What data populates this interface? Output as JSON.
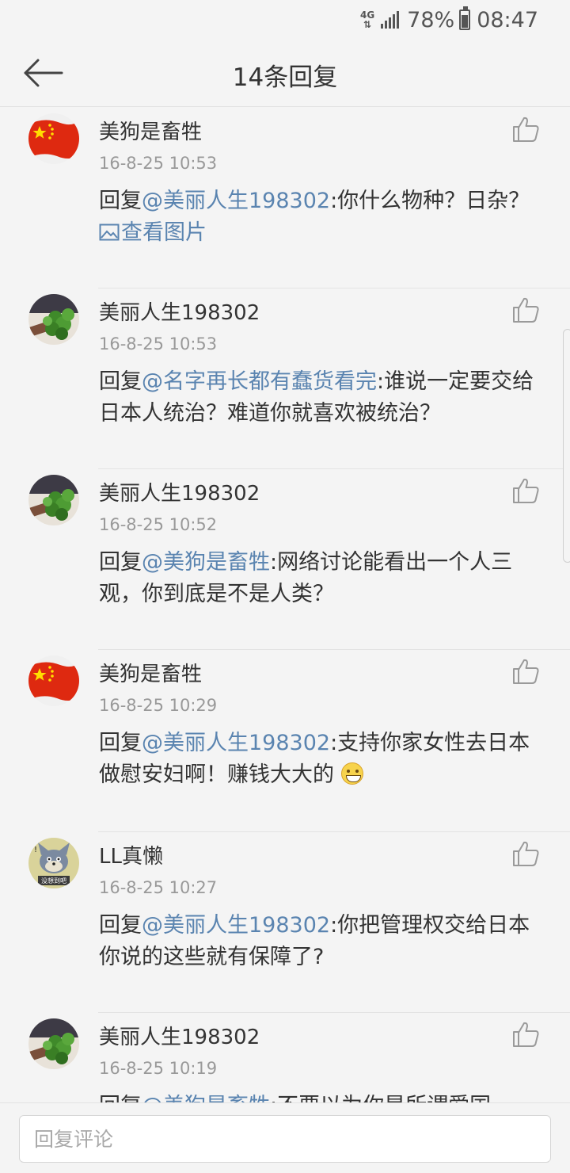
{
  "status_bar": {
    "network": "4G",
    "battery": "78%",
    "time": "08:47"
  },
  "header": {
    "title": "14条回复"
  },
  "replies": [
    {
      "user": "美狗是畜牲",
      "avatar": "china-flag-avatar",
      "time": "16-8-25 10:53",
      "prefix": "回复",
      "mention": "@美丽人生198302",
      "text": ":你什么物种？日杂？ ",
      "image_link": "查看图片"
    },
    {
      "user": "美丽人生198302",
      "avatar": "plant-avatar",
      "time": "16-8-25 10:53",
      "prefix": "回复",
      "mention": "@名字再长都有蠢货看完",
      "text": ":谁说一定要交给日本人统治？难道你就喜欢被统治？"
    },
    {
      "user": "美丽人生198302",
      "avatar": "plant-avatar",
      "time": "16-8-25 10:52",
      "prefix": "回复",
      "mention": "@美狗是畜牲",
      "text": ":网络讨论能看出一个人三观，你到底是不是人类？"
    },
    {
      "user": "美狗是畜牲",
      "avatar": "china-flag-avatar",
      "time": "16-8-25 10:29",
      "prefix": "回复",
      "mention": "@美丽人生198302",
      "text": ":支持你家女性去日本做慰安妇啊！赚钱大大的 "
    },
    {
      "user": "LL真懒",
      "avatar": "cartoon-cat-avatar",
      "avatar_caption": "没想到吧",
      "time": "16-8-25 10:27",
      "prefix": "回复",
      "mention": "@美丽人生198302",
      "text": ":你把管理权交给日本你说的这些就有保障了?"
    },
    {
      "user": "美丽人生198302",
      "avatar": "plant-avatar",
      "time": "16-8-25 10:19",
      "prefix": "回复",
      "mention": "@美狗是畜牲",
      "text": ":不要以为你是所谓爱国"
    }
  ],
  "reply_bar": {
    "placeholder": "回复评论"
  },
  "colors": {
    "link": "#5a84b0",
    "background": "#f4f4f4",
    "text": "#333333",
    "meta": "#999999"
  }
}
